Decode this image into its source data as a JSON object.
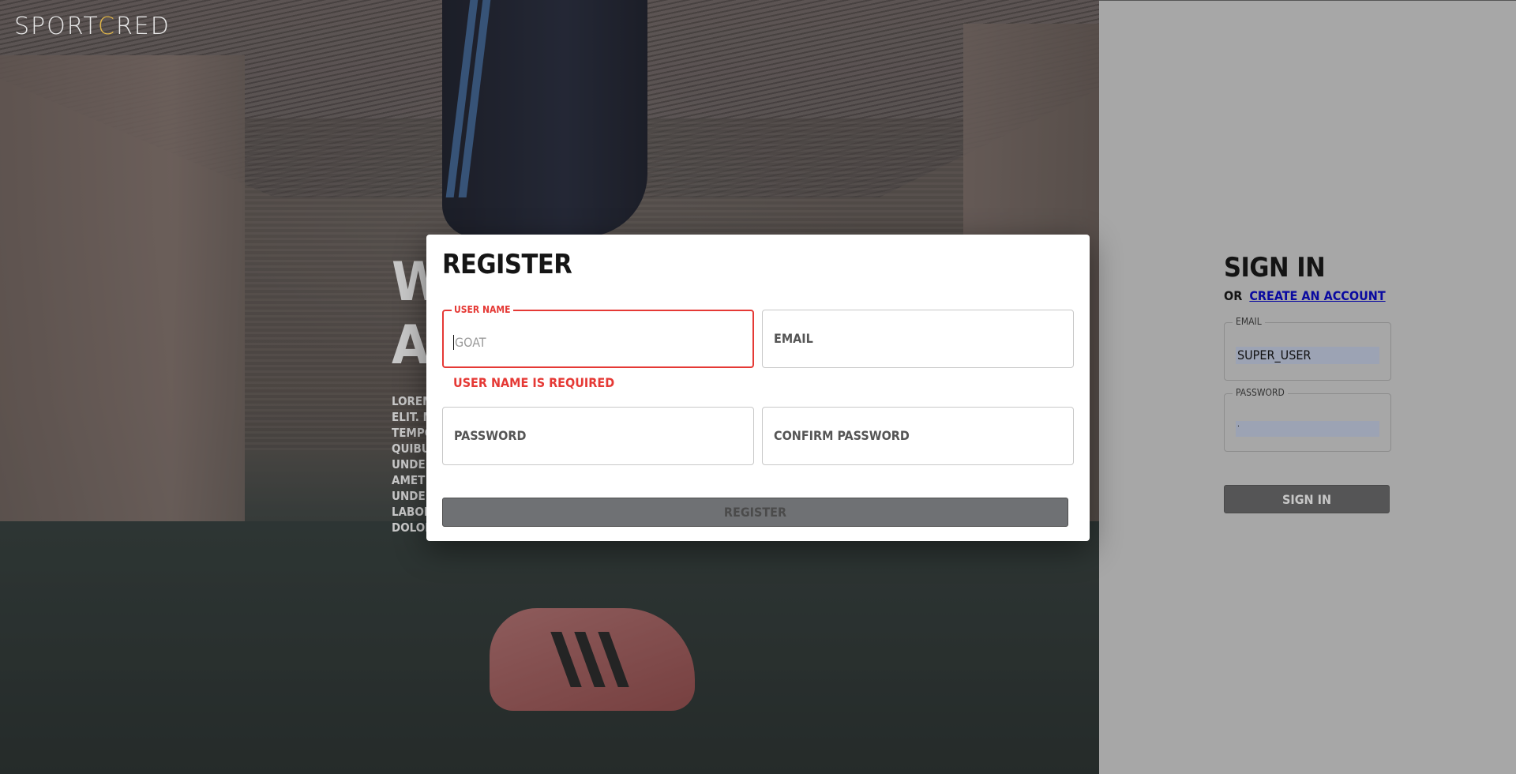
{
  "brand": {
    "logo_pre": "SPORT",
    "logo_accent": "C",
    "logo_post": "RED",
    "logo_color": "#e8e8e8",
    "accent_color": "#e0b64a"
  },
  "hero": {
    "title": "W\nA.",
    "paragraph": "LOREM\nELIT. M\nTEMPO\nQUIBUS\nUNDE E\nAMET C\nUNDE U\nLABOR\nDOLOR"
  },
  "signin": {
    "title": "SIGN IN",
    "or_text": "OR",
    "create_account_label": "CREATE AN ACCOUNT",
    "email_label": "EMAIL",
    "email_value": "SUPER_USER",
    "password_label": "PASSWORD",
    "password_value": ".",
    "button_label": "SIGN IN"
  },
  "register": {
    "title": "REGISTER",
    "username_label": "USER NAME",
    "username_placeholder": "GOAT",
    "error_prefix": "USER NAME IS ",
    "error_emphasis": "REQUIRED",
    "email_label": "EMAIL",
    "password_label": "PASSWORD",
    "confirm_password_label": "CONFIRM PASSWORD",
    "button_label": "REGISTER",
    "error_color": "#e53935"
  }
}
